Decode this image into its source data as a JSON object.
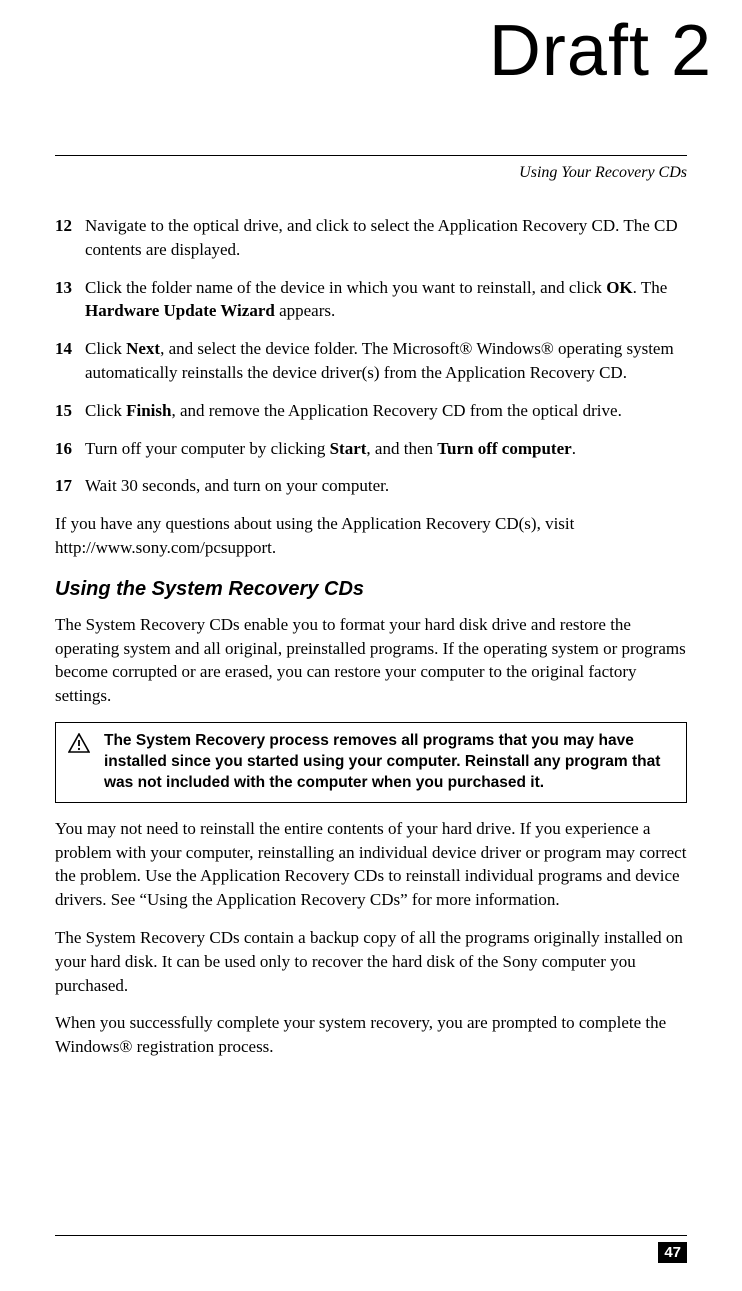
{
  "watermark": "Draft 2",
  "section_header": "Using Your Recovery CDs",
  "steps": [
    {
      "num": "12",
      "text": "Navigate to the optical drive, and click to select the Application Recovery CD. The CD contents are displayed."
    },
    {
      "num": "13",
      "text_parts": [
        "Click the folder name of the device in which you want to reinstall, and click ",
        "OK",
        ". The ",
        "Hardware Update Wizard",
        " appears."
      ]
    },
    {
      "num": "14",
      "text_parts": [
        "Click ",
        "Next",
        ", and select the device folder. The Microsoft® Windows® operating system automatically reinstalls the device driver(s) from the Application Recovery CD."
      ]
    },
    {
      "num": "15",
      "text_parts": [
        "Click ",
        "Finish",
        ", and remove the Application Recovery CD from the optical drive."
      ]
    },
    {
      "num": "16",
      "text_parts": [
        "Turn off your computer by clicking ",
        "Start",
        ", and then ",
        "Turn off computer",
        "."
      ]
    },
    {
      "num": "17",
      "text": "Wait 30 seconds, and turn on your computer."
    }
  ],
  "para_after_steps": "If you have any questions about using the Application Recovery CD(s), visit http://www.sony.com/pcsupport.",
  "subheading": "Using the System Recovery CDs",
  "para_desc": "The System Recovery CDs enable you to format your hard disk drive and restore the operating system and all original, preinstalled programs. If the operating system or programs become corrupted or are erased, you can restore your computer to the original factory settings.",
  "warning": "The System Recovery process removes all programs that you may have installed since you started using your computer. Reinstall any program that was not included with the computer when you purchased it.",
  "para_after_warning_1": "You may not need to reinstall the entire contents of your hard drive. If you experience a problem with your computer, reinstalling an individual device driver or program may correct the problem. Use the Application Recovery CDs to reinstall individual programs and device drivers. See “Using the Application Recovery CDs” for more information.",
  "para_after_warning_2": "The System Recovery CDs contain a backup copy of all the programs originally installed on your hard disk. It can be used only to recover the hard disk of the Sony computer you purchased.",
  "para_after_warning_3": "When you successfully complete your system recovery, you are prompted to complete the Windows® registration process.",
  "page_number": "47"
}
